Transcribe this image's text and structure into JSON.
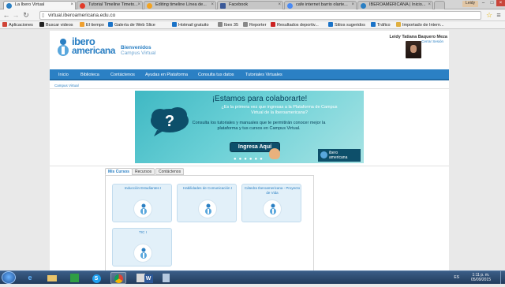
{
  "browser": {
    "tabs": [
      {
        "title": "La Ibero Virtual",
        "color": "#2a7fc3",
        "active": true
      },
      {
        "title": "Tutorial Timeline Timeto...",
        "color": "#e23b2a",
        "active": false
      },
      {
        "title": "Editing timeline Línea de...",
        "color": "#f3a321",
        "active": false
      },
      {
        "title": "Facebook",
        "color": "#3b5998",
        "active": false
      },
      {
        "title": "cafe internet barrio olarte...",
        "color": "#4a8af4",
        "active": false
      },
      {
        "title": "IBEROAMERICANA | Inicio...",
        "color": "#2a7fc3",
        "active": false
      }
    ],
    "profile_name": "Leidy",
    "url": "virtual.iberoamericana.edu.co",
    "bookmarks": [
      {
        "label": "Aplicaciones",
        "color": "#d04437"
      },
      {
        "label": "Buscar videos",
        "color": "#222222"
      },
      {
        "label": "El tiempo",
        "color": "#f0a030"
      },
      {
        "label": "Galería de Web Slice",
        "color": "#1a73c8"
      },
      {
        "label": "Hotmail gratuito",
        "color": "#1a73c8"
      },
      {
        "label": "Ibex 35",
        "color": "#888888"
      },
      {
        "label": "Reporter",
        "color": "#888888"
      },
      {
        "label": "Resultados deportiv...",
        "color": "#cc2222"
      },
      {
        "label": "Sitios sugeridos",
        "color": "#1a73c8"
      },
      {
        "label": "Tráfico",
        "color": "#1a73c8"
      },
      {
        "label": "Importado de Intern...",
        "color": "#e0b040"
      }
    ]
  },
  "site": {
    "logo_line1": "ibero",
    "logo_line2": "americana",
    "welcome": "Bienvenidos",
    "campus": "Campus Virtual",
    "user_name": "Leidy Tatiana Baquero Meza",
    "logout": "Cerrar Sesión",
    "menu": [
      "Inicio",
      "Biblioteca",
      "Contáctenos",
      "Ayudas en Plataforma",
      "Consulta tus datos",
      "Tutoriales Virtuales"
    ],
    "breadcrumb": "Campus Virtual",
    "brand_color": "#2b80c4"
  },
  "banner": {
    "title": "¡Estamos para colaborarte!",
    "subtitle": "¿Es la primera vez que ingresas a la Plataforma de Campus Virtual de la Iberoamericana?",
    "body": "Consulta los tutoriales y manuales que te permitirán conocer mejor la plataforma y tus cursos en Campus Virtual.",
    "button": "Ingresa Aquí",
    "logo_line1": "ibero",
    "logo_line2": "americana"
  },
  "courses": {
    "tabs": [
      "Mis Cursos",
      "Recursos",
      "Contáctenos"
    ],
    "cards": [
      {
        "title": "Inducción Estudiantes I"
      },
      {
        "title": "Habilidades de Comunicación I"
      },
      {
        "title": "Cátedra Iberoamericana - Proyecto de Vida"
      },
      {
        "title": "TIC I"
      }
    ]
  },
  "taskbar": {
    "lang": "ES",
    "time": "1:11 p. m.",
    "date": "05/09/2015"
  }
}
